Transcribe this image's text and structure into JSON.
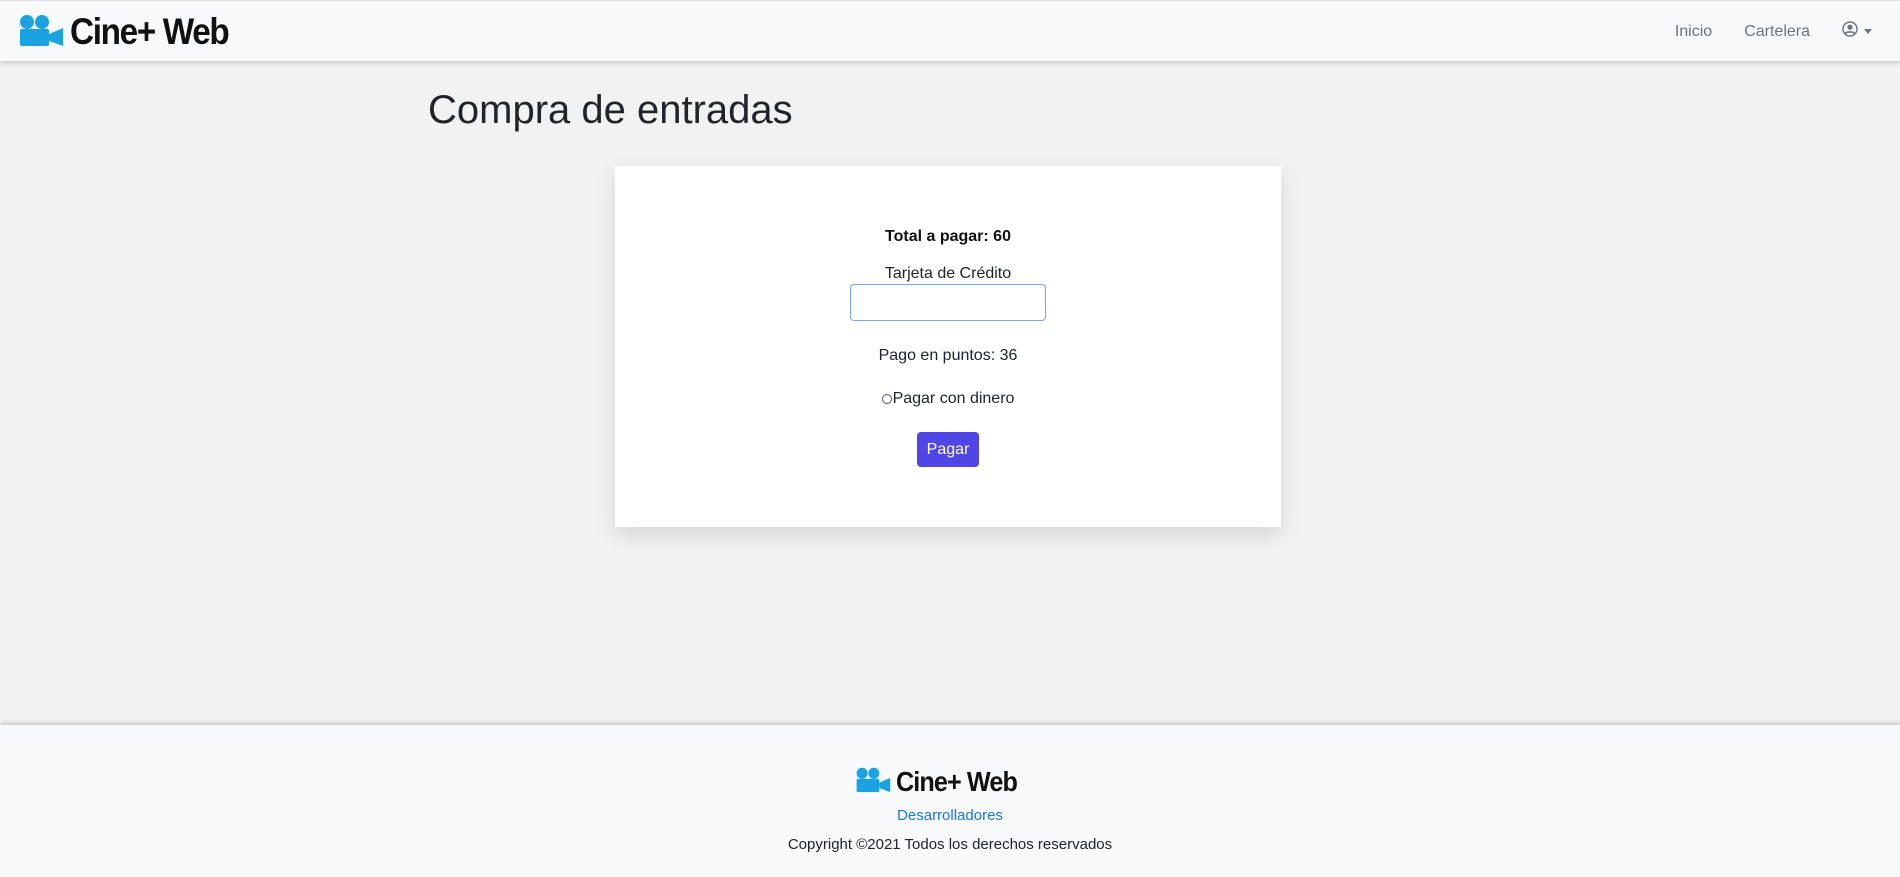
{
  "navbar": {
    "brand": "Cine+ Web",
    "links": {
      "inicio": "Inicio",
      "cartelera": "Cartelera"
    },
    "user_icon": "user-circle-icon"
  },
  "page": {
    "title": "Compra de entradas"
  },
  "payment": {
    "total_label": "Total a pagar: 60",
    "credit_card_label": "Tarjeta de Crédito",
    "credit_card_value": "",
    "points_label": "Pago en puntos: 36",
    "money_option_label": "Pagar con dinero",
    "money_option_selected": false,
    "pay_button": "Pagar"
  },
  "footer": {
    "brand": "Cine+ Web",
    "developers_link": "Desarrolladores",
    "copyright": "Copyright ©2021 Todos los derechos reservados"
  },
  "colors": {
    "brand_icon": "#1aa3e0",
    "pay_button": "#4f46e5",
    "link": "#1a73e8",
    "background": "#f2f2f2"
  }
}
